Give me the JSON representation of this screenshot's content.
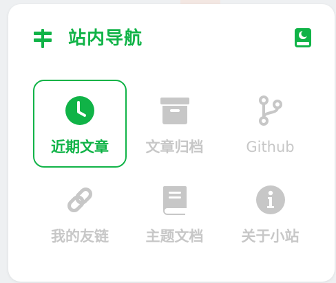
{
  "header": {
    "title": "站内导航",
    "left_icon": "signpost-icon",
    "right_icon": "book-moon-icon"
  },
  "colors": {
    "accent": "#10b347",
    "inactive": "#c7c7c7",
    "card_bg": "#ffffff"
  },
  "nav_items": [
    {
      "label": "近期文章",
      "icon": "clock-icon",
      "active": true
    },
    {
      "label": "文章归档",
      "icon": "archive-box-icon",
      "active": false
    },
    {
      "label": "Github",
      "icon": "code-branch-icon",
      "active": false
    },
    {
      "label": "我的友链",
      "icon": "link-icon",
      "active": false
    },
    {
      "label": "主题文档",
      "icon": "book-icon",
      "active": false
    },
    {
      "label": "关于小站",
      "icon": "info-circle-icon",
      "active": false
    }
  ]
}
